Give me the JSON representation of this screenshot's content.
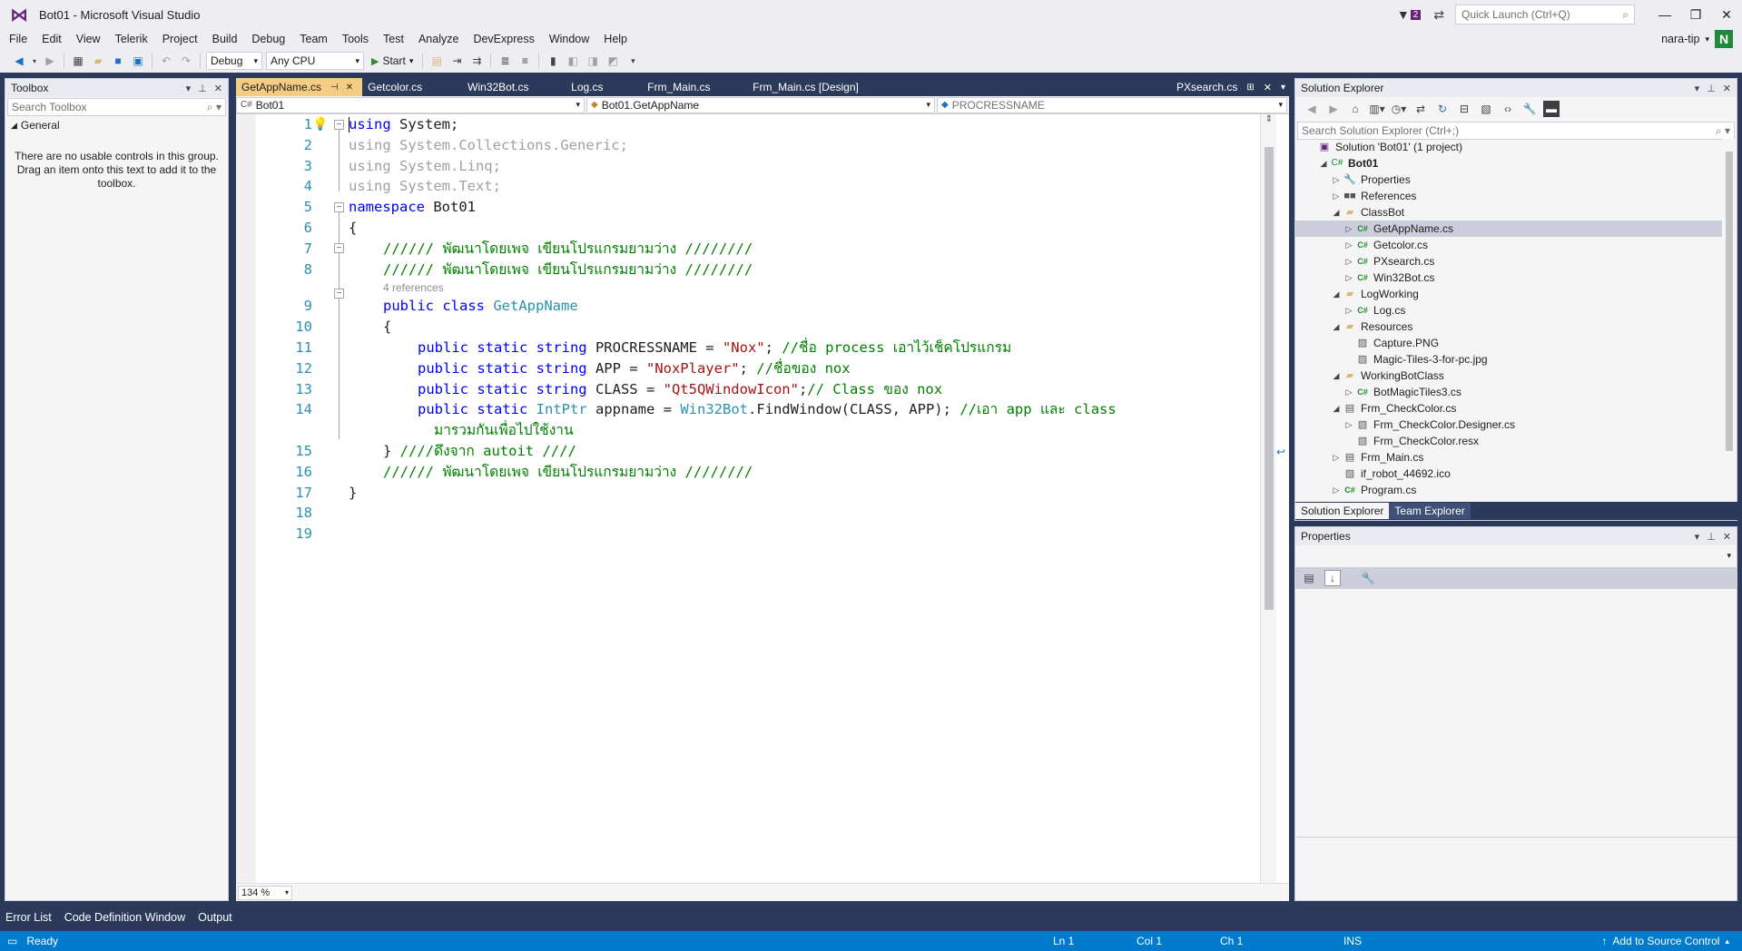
{
  "window": {
    "title": "Bot01 - Microsoft Visual Studio",
    "notification_count": "2",
    "quick_launch_placeholder": "Quick Launch (Ctrl+Q)",
    "user_name": "nara-tip",
    "user_initial": "N"
  },
  "menu": [
    "File",
    "Edit",
    "View",
    "Telerik",
    "Project",
    "Build",
    "Debug",
    "Team",
    "Tools",
    "Test",
    "Analyze",
    "DevExpress",
    "Window",
    "Help"
  ],
  "toolbar": {
    "config": "Debug",
    "platform": "Any CPU",
    "start_label": "Start"
  },
  "toolbox": {
    "title": "Toolbox",
    "search_placeholder": "Search Toolbox",
    "group": "General",
    "empty_line1": "There are no usable controls in this group.",
    "empty_line2": "Drag an item onto this text to add it to the",
    "empty_line3": "toolbox."
  },
  "editor": {
    "tabs": [
      "GetAppName.cs",
      "Getcolor.cs",
      "Win32Bot.cs",
      "Log.cs",
      "Frm_Main.cs",
      "Frm_Main.cs [Design]"
    ],
    "preview_tab": "PXsearch.cs",
    "nav_project": "Bot01",
    "nav_type": "Bot01.GetAppName",
    "nav_member": "PROCRESSNAME",
    "zoom": "134 %",
    "line_numbers": [
      "1",
      "2",
      "3",
      "4",
      "5",
      "6",
      "7",
      "8",
      "9",
      "10",
      "11",
      "12",
      "13",
      "14",
      "15",
      "16",
      "17",
      "18",
      "19"
    ],
    "references": "4 references",
    "code": {
      "l1_kw": "using",
      "l1_rest": " System;",
      "l2": "using System.Collections.Generic;",
      "l3": "using System.Linq;",
      "l4": "using System.Text;",
      "l5_kw": "namespace",
      "l5_rest": " Bot01",
      "l6": "{",
      "l7": "////// พัฒนาโดยเพจ เขียนโปรแกรมยามว่าง ////////",
      "l8": "////// พัฒนาโดยเพจ เขียนโปรแกรมยามว่าง ////////",
      "l9_kw": "public class",
      "l9_cls": "GetAppName",
      "l10": "{",
      "l11_kw": "public static string",
      "l11_name": " PROCRESSNAME = ",
      "l11_str": "\"Nox\"",
      "l11_semi": "; ",
      "l11_cmt": "//ชื่อ process เอาไว้เช็คโปรแกรม",
      "l12_kw": "public static string",
      "l12_name": " APP = ",
      "l12_str": "\"NoxPlayer\"",
      "l12_semi": "; ",
      "l12_cmt": "//ชื่อของ nox",
      "l13_kw": "public static string",
      "l13_name": " CLASS = ",
      "l13_str": "\"Qt5QWindowIcon\"",
      "l13_semi": ";",
      "l13_cmt": "// Class ของ nox",
      "l14_kw": "public static",
      "l14_type": "IntPtr",
      "l14_mid": " appname = ",
      "l14_cls": "Win32Bot",
      "l14_call": ".FindWindow(CLASS, APP); ",
      "l14_cmt": "//เอา app และ class",
      "l14b_cmt": "มารวมกันเพื่อไปใช้งาน",
      "l15_brace": "} ",
      "l15_cmt": "////ดึงจาก autoit ////",
      "l16": "////// พัฒนาโดยเพจ เขียนโปรแกรมยามว่าง ////////",
      "l17": "}"
    }
  },
  "solution_explorer": {
    "title": "Solution Explorer",
    "search_placeholder": "Search Solution Explorer (Ctrl+;)",
    "items": [
      {
        "label": "Solution 'Bot01' (1 project)",
        "icon": "sol",
        "depth": 0,
        "arrow": ""
      },
      {
        "label": "Bot01",
        "icon": "proj",
        "depth": 1,
        "arrow": "down",
        "bold": true
      },
      {
        "label": "Properties",
        "icon": "wrench",
        "depth": 2,
        "arrow": "right"
      },
      {
        "label": "References",
        "icon": "ref",
        "depth": 2,
        "arrow": "right"
      },
      {
        "label": "ClassBot",
        "icon": "folder",
        "depth": 2,
        "arrow": "down"
      },
      {
        "label": "GetAppName.cs",
        "icon": "cs",
        "depth": 3,
        "arrow": "right",
        "selected": true
      },
      {
        "label": "Getcolor.cs",
        "icon": "cs",
        "depth": 3,
        "arrow": "right"
      },
      {
        "label": "PXsearch.cs",
        "icon": "cs",
        "depth": 3,
        "arrow": "right"
      },
      {
        "label": "Win32Bot.cs",
        "icon": "cs",
        "depth": 3,
        "arrow": "right"
      },
      {
        "label": "LogWorking",
        "icon": "folder",
        "depth": 2,
        "arrow": "down"
      },
      {
        "label": "Log.cs",
        "icon": "cs",
        "depth": 3,
        "arrow": "right"
      },
      {
        "label": "Resources",
        "icon": "folder",
        "depth": 2,
        "arrow": "down"
      },
      {
        "label": "Capture.PNG",
        "icon": "img",
        "depth": 3,
        "arrow": ""
      },
      {
        "label": "Magic-Tiles-3-for-pc.jpg",
        "icon": "img",
        "depth": 3,
        "arrow": ""
      },
      {
        "label": "WorkingBotClass",
        "icon": "folder",
        "depth": 2,
        "arrow": "down"
      },
      {
        "label": "BotMagicTiles3.cs",
        "icon": "cs",
        "depth": 3,
        "arrow": "right"
      },
      {
        "label": "Frm_CheckColor.cs",
        "icon": "form",
        "depth": 2,
        "arrow": "down"
      },
      {
        "label": "Frm_CheckColor.Designer.cs",
        "icon": "resx",
        "depth": 3,
        "arrow": "right"
      },
      {
        "label": "Frm_CheckColor.resx",
        "icon": "resx",
        "depth": 3,
        "arrow": ""
      },
      {
        "label": "Frm_Main.cs",
        "icon": "form",
        "depth": 2,
        "arrow": "right"
      },
      {
        "label": "if_robot_44692.ico",
        "icon": "img",
        "depth": 2,
        "arrow": ""
      },
      {
        "label": "Program.cs",
        "icon": "cs",
        "depth": 2,
        "arrow": "right"
      }
    ],
    "tab_solution": "Solution Explorer",
    "tab_team": "Team Explorer"
  },
  "properties": {
    "title": "Properties"
  },
  "bottom_tabs": [
    "Error List",
    "Code Definition Window",
    "Output"
  ],
  "status": {
    "ready": "Ready",
    "ln": "Ln 1",
    "col": "Col 1",
    "ch": "Ch 1",
    "ins": "INS",
    "source_control": "Add to Source Control"
  }
}
